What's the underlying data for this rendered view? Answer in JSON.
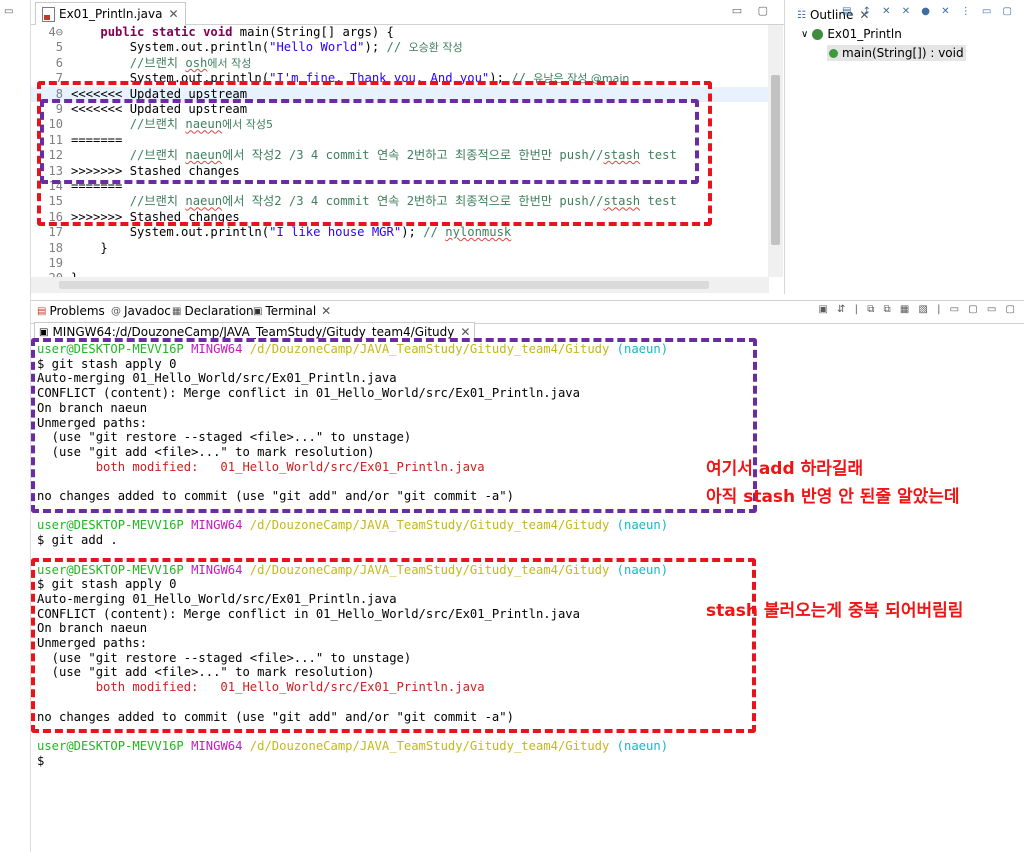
{
  "editor": {
    "tab_label": "Ex01_Println.java",
    "lines": [
      {
        "num": "4⊖",
        "parts": [
          {
            "t": "    "
          },
          {
            "t": "public static void",
            "c": "kw"
          },
          {
            "t": " main(String[] args) {"
          }
        ]
      },
      {
        "num": "5",
        "parts": [
          {
            "t": "        System.out.println("
          },
          {
            "t": "\"Hello World\"",
            "c": "str"
          },
          {
            "t": "); "
          },
          {
            "t": "// ",
            "c": "cm"
          },
          {
            "t": "오승환 작성",
            "c": "cm ko"
          }
        ]
      },
      {
        "num": "6",
        "parts": [
          {
            "t": "        "
          },
          {
            "t": "//브랜치 ",
            "c": "cm"
          },
          {
            "t": "osh",
            "c": "cm sq"
          },
          {
            "t": "에서 작성",
            "c": "cm ko"
          }
        ]
      },
      {
        "num": "7",
        "parts": [
          {
            "t": "        System.out.println("
          },
          {
            "t": "\"I'm fine. Thank you. And you\"",
            "c": "str"
          },
          {
            "t": "); "
          },
          {
            "t": "// ",
            "c": "cm"
          },
          {
            "t": "유남은 작성 @main",
            "c": "cm ko"
          }
        ]
      },
      {
        "num": "8",
        "hl": true,
        "parts": [
          {
            "t": "<<<<<<< Updated upstream"
          }
        ]
      },
      {
        "num": "9",
        "parts": [
          {
            "t": "<<<<<<< Updated upstream"
          }
        ]
      },
      {
        "num": "10",
        "parts": [
          {
            "t": "        "
          },
          {
            "t": "//브랜치 ",
            "c": "cm"
          },
          {
            "t": "naeun",
            "c": "cm sq"
          },
          {
            "t": "에서 작성5",
            "c": "cm ko"
          }
        ]
      },
      {
        "num": "11",
        "parts": [
          {
            "t": "======="
          }
        ]
      },
      {
        "num": "12",
        "parts": [
          {
            "t": "        "
          },
          {
            "t": "//브랜치 ",
            "c": "cm"
          },
          {
            "t": "naeun",
            "c": "cm sq"
          },
          {
            "t": "에서 작성2 /3 4 commit 연속 2번하고 최종적으로 한번만 push//",
            "c": "cm"
          },
          {
            "t": "stash",
            "c": "cm sq"
          },
          {
            "t": " test",
            "c": "cm"
          }
        ]
      },
      {
        "num": "13",
        "parts": [
          {
            "t": ">>>>>>> Stashed changes"
          }
        ]
      },
      {
        "num": "14",
        "parts": [
          {
            "t": "======="
          }
        ]
      },
      {
        "num": "15",
        "parts": [
          {
            "t": "        "
          },
          {
            "t": "//브랜치 ",
            "c": "cm"
          },
          {
            "t": "naeun",
            "c": "cm sq"
          },
          {
            "t": "에서 작성2 /3 4 commit 연속 2번하고 최종적으로 한번만 push//",
            "c": "cm"
          },
          {
            "t": "stash",
            "c": "cm sq"
          },
          {
            "t": " test",
            "c": "cm"
          }
        ]
      },
      {
        "num": "16",
        "parts": [
          {
            "t": ">>>>>>> Stashed changes"
          }
        ]
      },
      {
        "num": "17",
        "parts": [
          {
            "t": "        System.out.println("
          },
          {
            "t": "\"I like house MGR\"",
            "c": "str"
          },
          {
            "t": "); "
          },
          {
            "t": "// ",
            "c": "cm"
          },
          {
            "t": "nylonmusk",
            "c": "cm sq"
          }
        ]
      },
      {
        "num": "18",
        "parts": [
          {
            "t": "    }"
          }
        ]
      },
      {
        "num": "19",
        "parts": [
          {
            "t": ""
          }
        ]
      },
      {
        "num": "20",
        "parts": [
          {
            "t": "}"
          }
        ]
      }
    ]
  },
  "outline": {
    "tab_label": "Outline",
    "class_name": "Ex01_Println",
    "method_label": "main(String[]) : void"
  },
  "panel": {
    "tabs": [
      "Problems",
      "Javadoc",
      "Declaration",
      "Terminal"
    ],
    "terminal_tab": "MINGW64:/d/DouzoneCamp/JAVA_TeamStudy/Gitudy_team4/Gitudy"
  },
  "terminal": {
    "lines": [
      {
        "parts": [
          {
            "t": "user@DESKTOP-MEVV16P ",
            "c": "g"
          },
          {
            "t": "MINGW64 ",
            "c": "m"
          },
          {
            "t": "/d/DouzoneCamp/JAVA_TeamStudy/Gitudy_team4/Gitudy ",
            "c": "y"
          },
          {
            "t": "(naeun)",
            "c": "c"
          }
        ]
      },
      {
        "parts": [
          {
            "t": "$ git stash apply 0"
          }
        ]
      },
      {
        "parts": [
          {
            "t": "Auto-merging 01_Hello_World/src/Ex01_Println.java"
          }
        ]
      },
      {
        "parts": [
          {
            "t": "CONFLICT (content): Merge conflict in 01_Hello_World/src/Ex01_Println.java"
          }
        ]
      },
      {
        "parts": [
          {
            "t": "On branch naeun"
          }
        ]
      },
      {
        "parts": [
          {
            "t": "Unmerged paths:"
          }
        ]
      },
      {
        "parts": [
          {
            "t": "  (use \"git restore --staged <file>...\" to unstage)"
          }
        ]
      },
      {
        "parts": [
          {
            "t": "  (use \"git add <file>...\" to mark resolution)"
          }
        ]
      },
      {
        "parts": [
          {
            "t": "        both modified:   01_Hello_World/src/Ex01_Println.java",
            "c": "r"
          }
        ]
      },
      {
        "parts": [
          {
            "t": ""
          }
        ]
      },
      {
        "parts": [
          {
            "t": "no changes added to commit (use \"git add\" and/or \"git commit -a\")"
          }
        ]
      },
      {
        "parts": [
          {
            "t": ""
          }
        ]
      },
      {
        "parts": [
          {
            "t": "user@DESKTOP-MEVV16P ",
            "c": "g"
          },
          {
            "t": "MINGW64 ",
            "c": "m"
          },
          {
            "t": "/d/DouzoneCamp/JAVA_TeamStudy/Gitudy_team4/Gitudy ",
            "c": "y"
          },
          {
            "t": "(naeun)",
            "c": "c"
          }
        ]
      },
      {
        "parts": [
          {
            "t": "$ git add ."
          }
        ]
      },
      {
        "parts": [
          {
            "t": ""
          }
        ]
      },
      {
        "parts": [
          {
            "t": "user@DESKTOP-MEVV16P ",
            "c": "g"
          },
          {
            "t": "MINGW64 ",
            "c": "m"
          },
          {
            "t": "/d/DouzoneCamp/JAVA_TeamStudy/Gitudy_team4/Gitudy ",
            "c": "y"
          },
          {
            "t": "(naeun)",
            "c": "c"
          }
        ]
      },
      {
        "parts": [
          {
            "t": "$ git stash apply 0"
          }
        ]
      },
      {
        "parts": [
          {
            "t": "Auto-merging 01_Hello_World/src/Ex01_Println.java"
          }
        ]
      },
      {
        "parts": [
          {
            "t": "CONFLICT (content): Merge conflict in 01_Hello_World/src/Ex01_Println.java"
          }
        ]
      },
      {
        "parts": [
          {
            "t": "On branch naeun"
          }
        ]
      },
      {
        "parts": [
          {
            "t": "Unmerged paths:"
          }
        ]
      },
      {
        "parts": [
          {
            "t": "  (use \"git restore --staged <file>...\" to unstage)"
          }
        ]
      },
      {
        "parts": [
          {
            "t": "  (use \"git add <file>...\" to mark resolution)"
          }
        ]
      },
      {
        "parts": [
          {
            "t": "        both modified:   01_Hello_World/src/Ex01_Println.java",
            "c": "r"
          }
        ]
      },
      {
        "parts": [
          {
            "t": ""
          }
        ]
      },
      {
        "parts": [
          {
            "t": "no changes added to commit (use \"git add\" and/or \"git commit -a\")"
          }
        ]
      },
      {
        "parts": [
          {
            "t": ""
          }
        ]
      },
      {
        "parts": [
          {
            "t": "user@DESKTOP-MEVV16P ",
            "c": "g"
          },
          {
            "t": "MINGW64 ",
            "c": "m"
          },
          {
            "t": "/d/DouzoneCamp/JAVA_TeamStudy/Gitudy_team4/Gitudy ",
            "c": "y"
          },
          {
            "t": "(naeun)",
            "c": "c"
          }
        ]
      },
      {
        "parts": [
          {
            "t": "$"
          }
        ]
      }
    ]
  },
  "annotations": {
    "note1_line1": "여기서 add 하라길래",
    "note1_line2": "아직 stash 반영 안 된줄 알았는데",
    "note2": "stash 불러오는게 중복 되어버림림",
    "red_color": "#e8141c",
    "purple_color": "#6a2ca0"
  }
}
